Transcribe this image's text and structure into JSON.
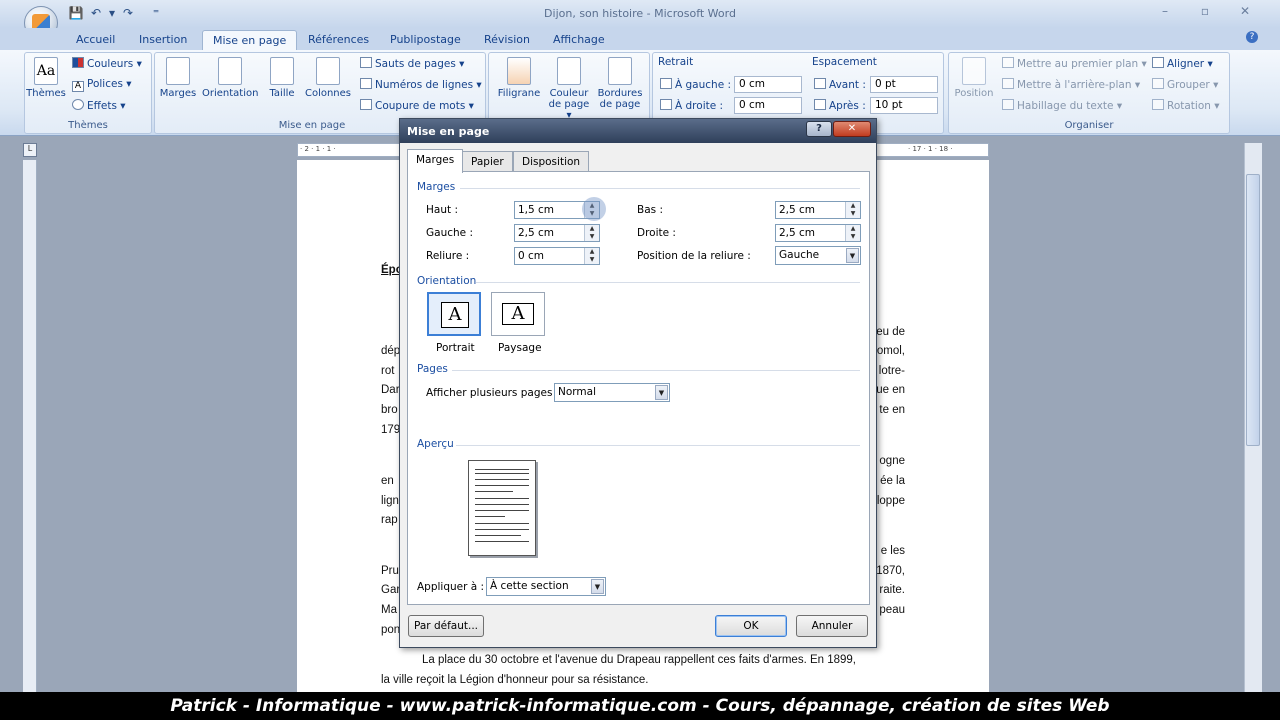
{
  "window": {
    "title": "Dijon, son histoire - Microsoft Word",
    "minimize": "–",
    "restore": "▫",
    "close": "✕"
  },
  "qat": {
    "save": "💾",
    "undo": "↶",
    "undo_more": "▾",
    "redo": "↷",
    "customize": "⁼"
  },
  "tabs": [
    "Accueil",
    "Insertion",
    "Mise en page",
    "Références",
    "Publipostage",
    "Révision",
    "Affichage"
  ],
  "active_tab": "Mise en page",
  "ribbon": {
    "themes": {
      "button": "Thèmes",
      "couleurs": "Couleurs ▾",
      "polices": "Polices ▾",
      "effets": "Effets ▾",
      "group": "Thèmes"
    },
    "page_setup": {
      "marges": "Marges",
      "orientation": "Orientation",
      "taille": "Taille",
      "colonnes": "Colonnes",
      "sauts": "Sauts de pages ▾",
      "numeros": "Numéros de lignes ▾",
      "coupure": "Coupure de mots ▾",
      "group": "Mise en page"
    },
    "background": {
      "filigrane": "Filigrane",
      "couleur_line1": "Couleur",
      "couleur_line2": "de page ▾",
      "bordures_line1": "Bordures",
      "bordures_line2": "de page"
    },
    "paragraph": {
      "retrait": "Retrait",
      "gauche_label": "À gauche :",
      "gauche_value": "0 cm",
      "droite_label": "À droite :",
      "droite_value": "0 cm",
      "espacement": "Espacement",
      "avant_label": "Avant :",
      "avant_value": "0 pt",
      "apres_label": "Après :",
      "apres_value": "10 pt"
    },
    "arrange": {
      "position": "Position",
      "premier_plan": "Mettre au premier plan ▾",
      "arriere_plan": "Mettre à l'arrière-plan ▾",
      "habillage": "Habillage du texte ▾",
      "aligner": "Aligner ▾",
      "grouper": "Grouper ▾",
      "rotation": "Rotation ▾",
      "group": "Organiser"
    }
  },
  "ruler": {
    "left_marks": "· 2 · 1 · 1 · ",
    "right_marks": "· 17 · 1 · 18 ·",
    "corner": "L"
  },
  "document": {
    "heading_frag": "Épo",
    "left_frags": [
      "dép",
      "rot",
      "Dar",
      "bro",
      "179",
      "en",
      "lign",
      "rap",
      "Pru",
      "Gar",
      "Ma",
      "pon"
    ],
    "right_frags": [
      "eu de",
      "omol,",
      "lotre-",
      "ue en",
      "te en",
      "ogne",
      "ée la",
      "loppe",
      "e les",
      "1870,",
      "raite.",
      "peau"
    ],
    "line1": "La place du 30 octobre et l'avenue du Drapeau rappellent ces faits d'armes. En 1899,",
    "line2": "la ville reçoit la Légion d'honneur  pour sa résistance."
  },
  "dialog": {
    "title": "Mise en page",
    "help": "?",
    "close": "✕",
    "tabs": [
      "Marges",
      "Papier",
      "Disposition"
    ],
    "active_tab": "Marges",
    "margins_section": "Marges",
    "haut_label": "Haut :",
    "haut_value": "1,5 cm",
    "bas_label": "Bas :",
    "bas_value": "2,5 cm",
    "gauche_label": "Gauche :",
    "gauche_value": "2,5 cm",
    "droite_label": "Droite :",
    "droite_value": "2,5 cm",
    "reliure_label": "Reliure :",
    "reliure_value": "0 cm",
    "position_reliure_label": "Position de la reliure :",
    "position_reliure_value": "Gauche",
    "orientation_section": "Orientation",
    "portrait": "Portrait",
    "paysage": "Paysage",
    "pages_section": "Pages",
    "plusieurs_pages_label": "Afficher plusieurs pages :",
    "plusieurs_pages_value": "Normal",
    "apercu_section": "Aperçu",
    "appliquer_label": "Appliquer à :",
    "appliquer_value": "À cette section",
    "par_defaut": "Par défaut...",
    "ok": "OK",
    "annuler": "Annuler"
  },
  "banner": "Patrick - Informatique - www.patrick-informatique.com - Cours, dépannage, création de sites Web"
}
